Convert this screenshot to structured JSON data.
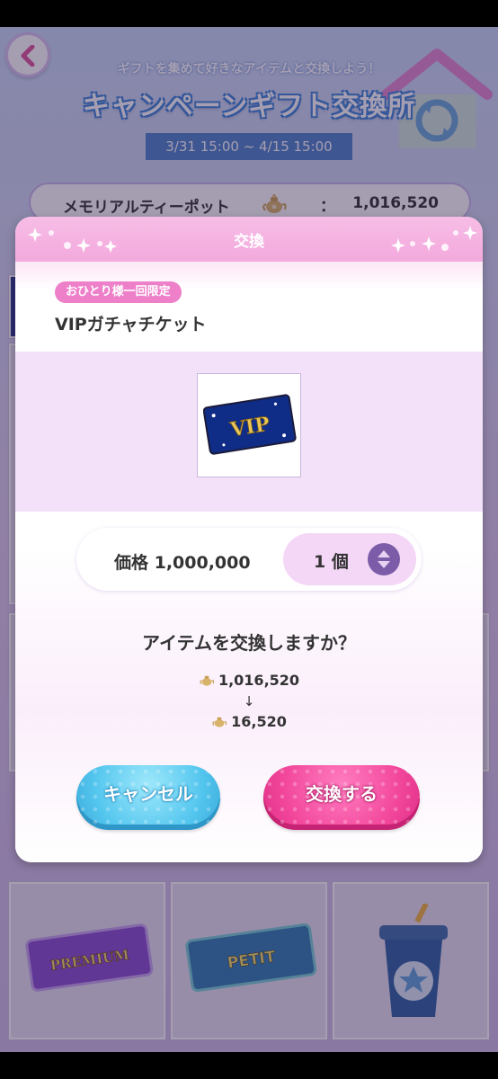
{
  "header": {
    "subtitle": "ギフトを集めて好きなアイテムと交換しよう！",
    "title": "キャンペーンギフト交換所",
    "period": "3/31 15:00 ~ 4/15 15:00"
  },
  "currency": {
    "name": "メモリアルティーポット",
    "colon": "：",
    "amount": "1,016,520",
    "icon": "teapot-icon"
  },
  "grid_items": [
    {
      "label": "PREMIUM",
      "icon": "premium-ticket"
    },
    {
      "label": "PETIT",
      "icon": "petit-ticket"
    },
    {
      "label": "",
      "icon": "drink-cup-icon"
    }
  ],
  "dialog": {
    "title": "交換",
    "limit_badge": "おひとり様一回限定",
    "item_name": "VIPガチャチケット",
    "item_icon_label": "VIP",
    "price": "価格 1,000,000",
    "quantity": "1 個",
    "question": "アイテムを交換しますか？",
    "current_amount": "1,016,520",
    "arrow": "↓",
    "after_amount": "16,520",
    "cancel_label": "キャンセル",
    "confirm_label": "交換する"
  },
  "colors": {
    "header_pink": "#f3a9dd",
    "badge_pink": "#ee7fc9",
    "cancel_blue": "#52c5ee",
    "confirm_pink": "#f2469b",
    "title_blue": "#3f86d6"
  }
}
